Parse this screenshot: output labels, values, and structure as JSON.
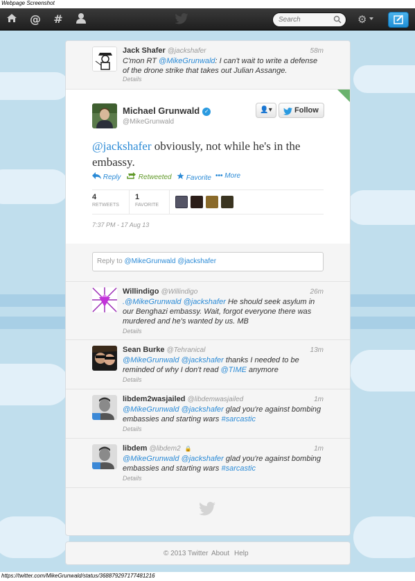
{
  "caption": "Webpage Screenshot",
  "topbar": {
    "nav_icons": [
      "home-icon",
      "mentions-icon",
      "discover-icon",
      "profile-icon"
    ],
    "nav_glyphs": [
      "⌂",
      "@",
      "#",
      "👤"
    ],
    "search_placeholder": "Search",
    "accent": "#2a9ae0"
  },
  "prev_tweet": {
    "name": "Jack Shafer",
    "handle": "@jackshafer",
    "time": "58m",
    "text_prefix": "C'mon RT ",
    "mention": "@MikeGrunwald",
    "text_suffix": ": I can't wait to write a defense of the drone strike that takes out Julian Assange.",
    "details": "Details"
  },
  "focus_tweet": {
    "name": "Michael Grunwald",
    "handle": "@MikeGrunwald",
    "user_button": "👤▾",
    "follow_label": "Follow",
    "mention": "@jackshafer",
    "text": " obviously, not while he's in the embassy.",
    "actions": {
      "reply": "Reply",
      "retweeted": "Retweeted",
      "favorite": "Favorite",
      "more": "More"
    },
    "retweets_count": "4",
    "retweets_label": "RETWEETS",
    "favorites_count": "1",
    "favorites_label": "FAVORITE",
    "timestamp": "7:37 PM - 17 Aug 13"
  },
  "reply_box": {
    "prefix": "Reply to ",
    "mentions": "@MikeGrunwald @jackshafer"
  },
  "replies": [
    {
      "name": "Willindigo",
      "handle": "@Willindigo",
      "time": "26m",
      "mentions": ".@MikeGrunwald @jackshafer",
      "text": " He should seek asylum in our Benghazi embassy. Wait, forgot everyone there was murdered and he's wanted by us. MB",
      "details": "Details"
    },
    {
      "name": "Sean Burke",
      "handle": "@Tehranical",
      "time": "13m",
      "mentions": "@MikeGrunwald @jackshafer",
      "text": " thanks I needed to be reminded of why I don't read ",
      "mention2": "@TIME",
      "text2": " anymore",
      "details": "Details"
    },
    {
      "name": "libdem2wasjailed",
      "handle": "@libdemwasjailed",
      "time": "1m",
      "mentions": "@MikeGrunwald @jackshafer",
      "text": " glad you're against bombing embassies and starting wars ",
      "hashtag": "#sarcastic",
      "details": "Details"
    },
    {
      "name": "libdem",
      "handle": "@libdem2",
      "lock": "🔒",
      "time": "1m",
      "mentions": "@MikeGrunwald @jackshafer",
      "text": " glad you're against bombing embassies and starting wars ",
      "hashtag": "#sarcastic",
      "details": "Details"
    }
  ],
  "footer": {
    "copyright": "© 2013 Twitter",
    "about": "About",
    "help": "Help"
  },
  "status_url": "https://twitter.com/MikeGrunwald/status/368879297177481216"
}
